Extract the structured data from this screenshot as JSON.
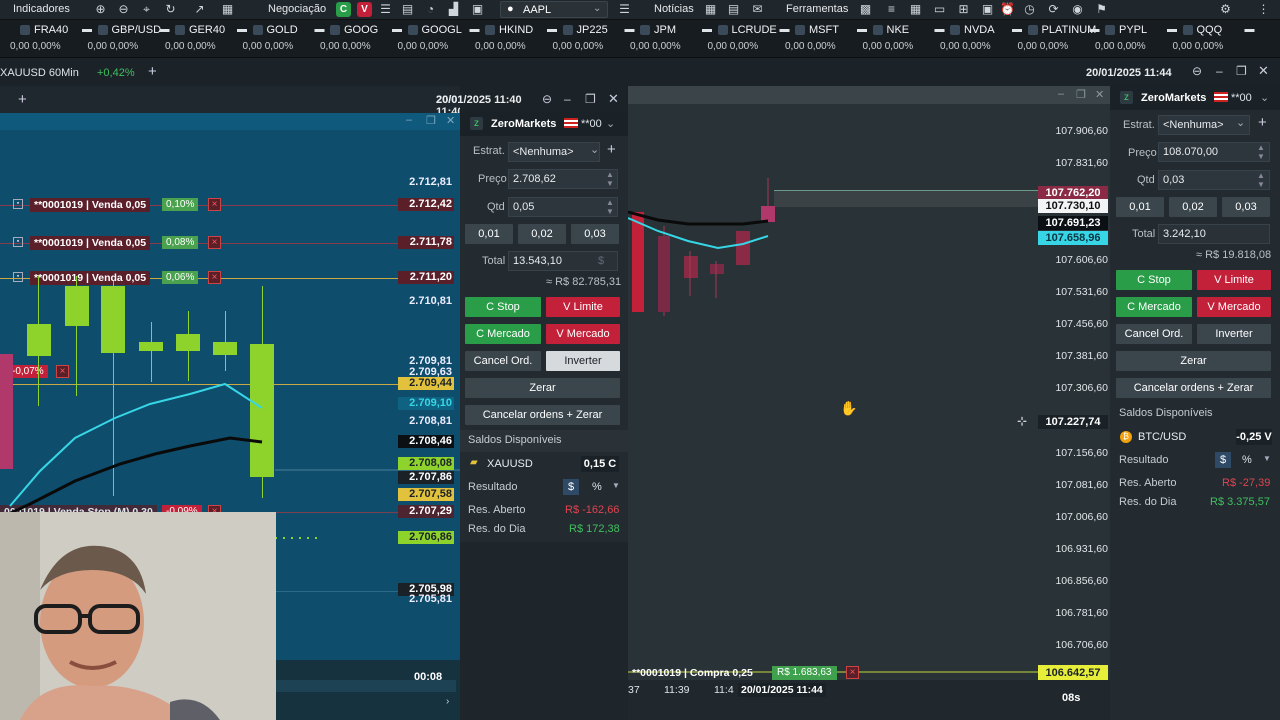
{
  "toolbar": {
    "indicators": "Indicadores",
    "trading": "Negociação",
    "symbol": "AAPL",
    "news": "Notícias",
    "tools": "Ferramentas",
    "c_btn": "C",
    "v_btn": "V"
  },
  "ticker": [
    {
      "name": "FRA40",
      "values": "0,00   0,00%"
    },
    {
      "name": "GBP/USD",
      "values": "0,00   0,00%"
    },
    {
      "name": "GER40",
      "values": "0,00   0,00%"
    },
    {
      "name": "GOLD",
      "values": "0,00   0,00%"
    },
    {
      "name": "GOOG",
      "values": "0,00   0,00%"
    },
    {
      "name": "GOOGL",
      "values": "0,00   0,00%"
    },
    {
      "name": "HKIND",
      "values": "0,00   0,00%"
    },
    {
      "name": "JP225",
      "values": "0,00   0,00%"
    },
    {
      "name": "JPM",
      "values": "0,00   0,00%"
    },
    {
      "name": "LCRUDE",
      "values": "0,00   0,00%"
    },
    {
      "name": "MSFT",
      "values": "0,00   0,00%"
    },
    {
      "name": "NKE",
      "values": "0,00   0,00%"
    },
    {
      "name": "NVDA",
      "values": "0,00   0,00%"
    },
    {
      "name": "PLATINUM",
      "values": "0,00   0,00%"
    },
    {
      "name": "PYPL",
      "values": "0,00   0,00%"
    },
    {
      "name": "QQQ",
      "values": "0,00   0,00%"
    }
  ],
  "chartbar": {
    "symbol": "XAUUSD 60Min",
    "change": "+0,42%",
    "datetime": "20/01/2025 11:44"
  },
  "left_chart": {
    "datetime": "20/01/2025 11:40",
    "orders": [
      {
        "label": "**0001019 | Venda 0,05",
        "pct": "0,10%",
        "price": "2.712,42"
      },
      {
        "label": "**0001019 | Venda 0,05",
        "pct": "0,08%",
        "price": "2.711,78"
      },
      {
        "label": "**0001019 | Venda 0,05",
        "pct": "0,06%",
        "price": "2.711,20"
      }
    ],
    "stop_order": {
      "label": "0001019 | Venda Stop (M) 0,30",
      "pct": "-0,09%",
      "price": "2.707,29"
    },
    "neg_pct": "-0,07%",
    "prices": {
      "p1": "2.712,81",
      "p2": "2.710,81",
      "p3": "2.709,81",
      "p4": "2.709,63",
      "p5": "2.709,44",
      "p6": "2.709,10",
      "p7": "2.708,81",
      "p8": "2.708,46",
      "p9": "2.708,08",
      "p10": "2.707,86",
      "p11": "2.707,58",
      "p12": "2.706,86",
      "p13": "2.705,98",
      "p14": "2.705,81"
    },
    "timer": "00:08"
  },
  "panel_left": {
    "broker": "ZeroMarkets",
    "account": "**00",
    "strategy_label": "Estrat.",
    "strategy_value": "<Nenhuma>",
    "price_label": "Preço",
    "price_value": "2.708,62",
    "qty_label": "Qtd",
    "qty_value": "0,05",
    "q1": "0,01",
    "q2": "0,02",
    "q3": "0,03",
    "total_label": "Total",
    "total_value": "13.543,10",
    "total_unit": "$",
    "approx": "≈ R$ 82.785,31",
    "c_stop": "C Stop",
    "v_limite": "V Limite",
    "c_mercado": "C Mercado",
    "v_mercado": "V Mercado",
    "cancel": "Cancel Ord.",
    "invert": "Inverter",
    "zerar": "Zerar",
    "cancel_zerar": "Cancelar ordens + Zerar",
    "balances_title": "Saldos Disponíveis",
    "asset": "XAUUSD",
    "asset_pos": "0,15 C",
    "result_label": "Resultado",
    "currency": "$",
    "percent": "%",
    "open_label": "Res. Aberto",
    "open_value": "R$ -162,66",
    "day_label": "Res. do Dia",
    "day_value": "R$ 172,38"
  },
  "right_chart": {
    "ylabels": [
      "107.906,60",
      "107.831,60",
      "107.606,60",
      "107.531,60",
      "107.456,60",
      "107.381,60",
      "107.306,60",
      "107.156,60",
      "107.081,60",
      "107.006,60",
      "106.931,60",
      "106.856,60",
      "106.781,60",
      "106.706,60"
    ],
    "tag_red": "107.762,20",
    "tag_white": "107.730,10",
    "tag_dark": "107.691,23",
    "tag_cyan": "107.658,96",
    "tag_cursor": "107.227,74",
    "tag_bottom": "106.642,57",
    "order_label": "**0001019 | Compra 0,25",
    "order_value": "R$ 1.683,63",
    "times": [
      "37",
      "11:39",
      "11:4"
    ],
    "time_current": "20/01/2025 11:44",
    "timer": "08s"
  },
  "panel_right": {
    "broker": "ZeroMarkets",
    "account": "**00",
    "strategy_label": "Estrat.",
    "strategy_value": "<Nenhuma>",
    "price_label": "Preço",
    "price_value": "108.070,00",
    "qty_label": "Qtd",
    "qty_value": "0,03",
    "q1": "0,01",
    "q2": "0,02",
    "q3": "0,03",
    "total_label": "Total",
    "total_value": "3.242,10",
    "approx": "≈ R$ 19.818,08",
    "c_stop": "C Stop",
    "v_limite": "V Limite",
    "c_mercado": "C Mercado",
    "v_mercado": "V Mercado",
    "cancel": "Cancel Ord.",
    "invert": "Inverter",
    "zerar": "Zerar",
    "cancel_zerar": "Cancelar ordens + Zerar",
    "balances_title": "Saldos Disponíveis",
    "asset": "BTC/USD",
    "asset_pos": "-0,25 V",
    "result_label": "Resultado",
    "currency": "$",
    "percent": "%",
    "open_label": "Res. Aberto",
    "open_value": "R$ -27,39",
    "day_label": "Res. do Dia",
    "day_value": "R$ 3.375,57"
  },
  "colors": {
    "buy": "#2a9d49",
    "sell": "#c3213a",
    "gold_line": "#e2c23c",
    "cyan": "#37d6e6"
  }
}
